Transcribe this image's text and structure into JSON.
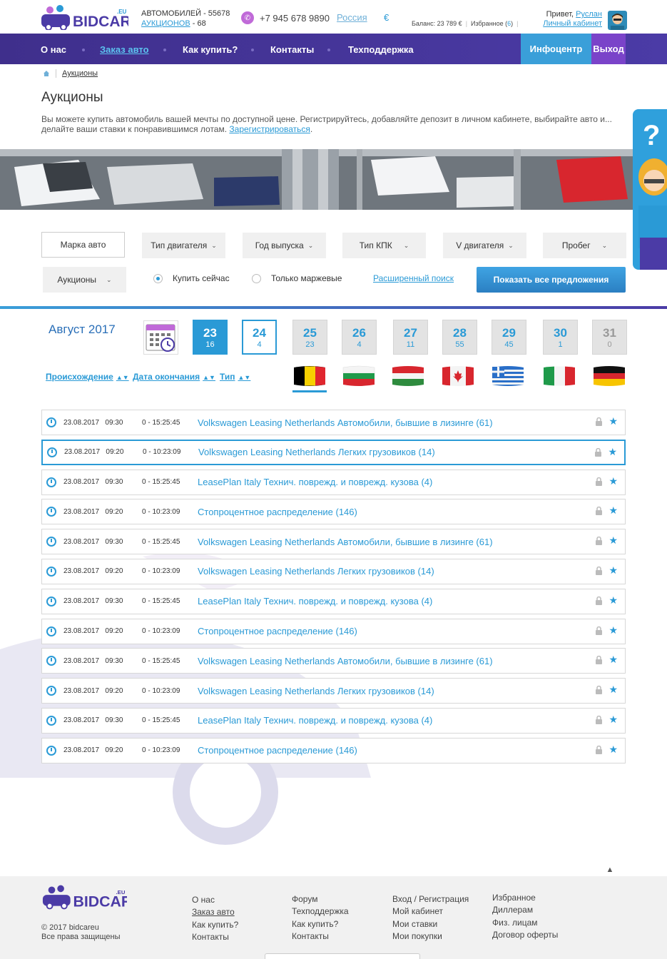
{
  "header": {
    "logo_text": "BIDCAR",
    "logo_tld": ".EU",
    "cars_label": "АВТОМОБИЛЕЙ - 55678",
    "auctions_link": "АУКЦИОНОВ",
    "auctions_count": " - 68",
    "phone": "+7 945 678 9890",
    "country": "Россия",
    "currency": "€",
    "balance": "Баланс: 23 789 €",
    "favorites_label": "Избранное (",
    "favorites_count": "6",
    "favorites_close": ")",
    "cabinet_link": "Личный кабинет",
    "greeting": "Привет, ",
    "user_name": "Руслан"
  },
  "nav": {
    "items": [
      "О нас",
      "Заказ авто",
      "Как купить?",
      "Контакты",
      "Техподдержка"
    ],
    "info": "Инфоцентр",
    "exit": "Выход"
  },
  "breadcrumb": {
    "current": "Аукционы"
  },
  "page": {
    "title": "Аукционы",
    "intro": "Вы можете купить автомобиль вашей мечты по доступной цене. Регистрируйтесь, добавляйте депозит в личном кабинете, выбирайте авто и... делайте ваши ставки к понравившимся лотам. ",
    "register_link": "Зарегистрироваться",
    "intro_end": "."
  },
  "filters": {
    "brand": "Марка авто",
    "engine_type": "Тип двигателя",
    "year": "Год выпуска",
    "gearbox": "Тип КПК",
    "engine_volume": "V двигателя",
    "mileage": "Пробег",
    "auctions": "Аукционы",
    "buy_now": "Купить сейчас",
    "margin_only": "Только маржевые",
    "advanced": "Расширенный поиск",
    "show_all": "Показать все предложения"
  },
  "calendar": {
    "month": "Август 2017",
    "days": [
      {
        "n": "23",
        "c": "16"
      },
      {
        "n": "24",
        "c": "4"
      },
      {
        "n": "25",
        "c": "23"
      },
      {
        "n": "26",
        "c": "4"
      },
      {
        "n": "27",
        "c": "11"
      },
      {
        "n": "28",
        "c": "55"
      },
      {
        "n": "29",
        "c": "45"
      },
      {
        "n": "30",
        "c": "1"
      },
      {
        "n": "31",
        "c": "0"
      }
    ]
  },
  "sort": {
    "origin": "Происхождение",
    "end_date": "Дата окончания",
    "type": "Тип"
  },
  "flags": [
    "belgium-flag",
    "bulgaria-flag",
    "hungary-flag",
    "canada-flag",
    "greece-flag",
    "italy-flag",
    "germany-flag"
  ],
  "auctions": [
    {
      "date": "23.08.2017   09:30",
      "time": "0 - 15:25:45",
      "name": "Volkswagen Leasing Netherlands Автомобили, бывшие в лизинге (61)"
    },
    {
      "date": "23.08.2017   09:20",
      "time": "0 - 10:23:09",
      "name": "Volkswagen Leasing Netherlands Легких грузовиков (14)"
    },
    {
      "date": "23.08.2017   09:30",
      "time": "0 - 15:25:45",
      "name": "LeasePlan Italy Технич. поврежд. и поврежд. кузова (4)"
    },
    {
      "date": "23.08.2017   09:20",
      "time": "0 - 10:23:09",
      "name": "Стопроцентное распределение (146)"
    },
    {
      "date": "23.08.2017   09:30",
      "time": "0 - 15:25:45",
      "name": "Volkswagen Leasing Netherlands Автомобили, бывшие в лизинге (61)"
    },
    {
      "date": "23.08.2017   09:20",
      "time": "0 - 10:23:09",
      "name": "Volkswagen Leasing Netherlands Легких грузовиков (14)"
    },
    {
      "date": "23.08.2017   09:30",
      "time": "0 - 15:25:45",
      "name": "LeasePlan Italy Технич. поврежд. и поврежд. кузова (4)"
    },
    {
      "date": "23.08.2017   09:20",
      "time": "0 - 10:23:09",
      "name": "Стопроцентное распределение (146)"
    },
    {
      "date": "23.08.2017   09:30",
      "time": "0 - 15:25:45",
      "name": "Volkswagen Leasing Netherlands Автомобили, бывшие в лизинге (61)"
    },
    {
      "date": "23.08.2017   09:20",
      "time": "0 - 10:23:09",
      "name": "Volkswagen Leasing Netherlands Легких грузовиков (14)"
    },
    {
      "date": "23.08.2017   09:30",
      "time": "0 - 15:25:45",
      "name": "LeasePlan Italy Технич. поврежд. и поврежд. кузова (4)"
    },
    {
      "date": "23.08.2017   09:20",
      "time": "0 - 10:23:09",
      "name": "Стопроцентное распределение (146)"
    }
  ],
  "footer": {
    "copyright": "© 2017 bidcareu",
    "rights": "Все права защищены",
    "col1": [
      "О нас",
      "Заказ авто",
      "Как купить?",
      "Контакты"
    ],
    "col2": [
      "Форум",
      "Техподдержка",
      "Как купить?",
      "Контакты"
    ],
    "col3": [
      "Вход / Регистрация",
      "Мой кабинет",
      "Мои ставки",
      "Мои покупки"
    ],
    "col4": [
      "Избранное",
      "Диллерам",
      "Физ. лицам",
      "Договор оферты"
    ]
  },
  "colors": {
    "accent": "#2a9ad6",
    "nav": "#4b3ba6",
    "exit": "#7a43c9"
  }
}
